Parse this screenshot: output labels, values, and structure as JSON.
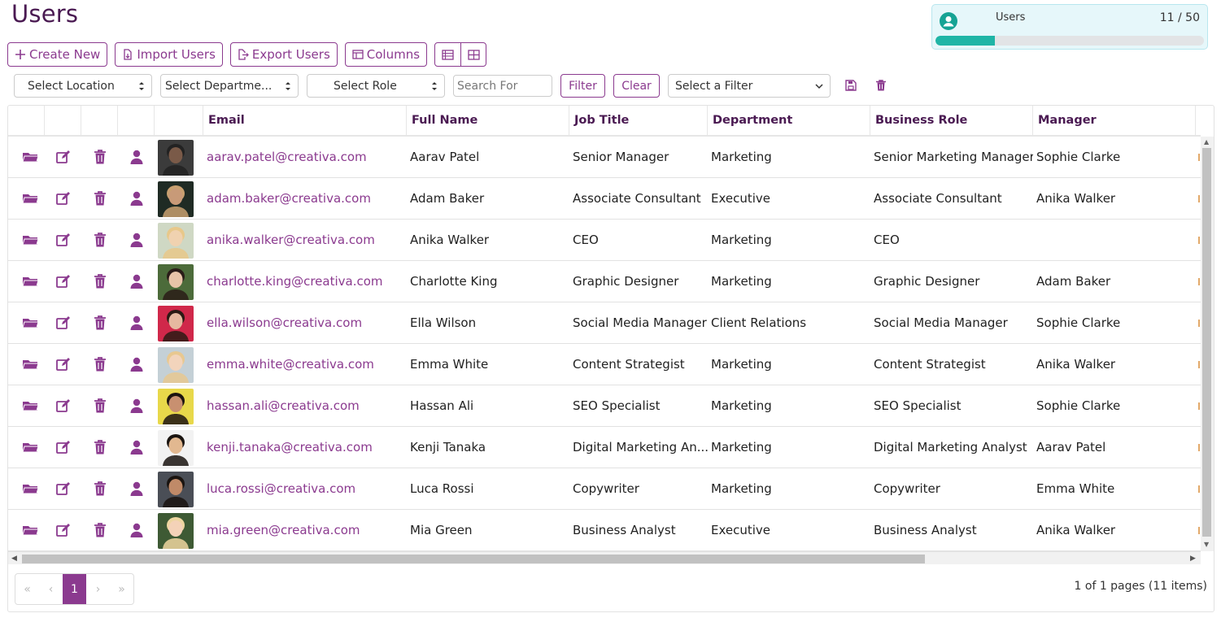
{
  "page": {
    "title": "Users"
  },
  "quota": {
    "label": "Users",
    "count": "11 / 50",
    "used": 11,
    "max": 50,
    "bar_color": "#1fb5a6",
    "icon": "user-circle-icon"
  },
  "toolbar": {
    "create_new": "Create New",
    "import_users": "Import Users",
    "export_users": "Export Users",
    "columns": "Columns"
  },
  "filters": {
    "location": "Select Location",
    "department": "Select Departme...",
    "role": "Select Role",
    "search_placeholder": "Search For",
    "filter_button": "Filter",
    "clear_button": "Clear",
    "saved_filter": "Select a Filter"
  },
  "columns": [
    "Email",
    "Full Name",
    "Job Title",
    "Department",
    "Business Role",
    "Manager"
  ],
  "rows": [
    {
      "email": "aarav.patel@creativa.com",
      "name": "Aarav Patel",
      "job": "Senior Manager",
      "dept": "Marketing",
      "role": "Senior Marketing Manager",
      "manager": "Sophie Clarke"
    },
    {
      "email": "adam.baker@creativa.com",
      "name": "Adam Baker",
      "job": "Associate Consultant",
      "dept": "Executive",
      "role": "Associate Consultant",
      "manager": "Anika Walker"
    },
    {
      "email": "anika.walker@creativa.com",
      "name": "Anika Walker",
      "job": "CEO",
      "dept": "Marketing",
      "role": "CEO",
      "manager": ""
    },
    {
      "email": "charlotte.king@creativa.com",
      "name": "Charlotte King",
      "job": "Graphic Designer",
      "dept": "Marketing",
      "role": "Graphic Designer",
      "manager": "Adam Baker"
    },
    {
      "email": "ella.wilson@creativa.com",
      "name": "Ella Wilson",
      "job": "Social Media Manager",
      "dept": "Client Relations",
      "role": "Social Media Manager",
      "manager": "Sophie Clarke"
    },
    {
      "email": "emma.white@creativa.com",
      "name": "Emma White",
      "job": "Content Strategist",
      "dept": "Marketing",
      "role": "Content Strategist",
      "manager": "Anika Walker"
    },
    {
      "email": "hassan.ali@creativa.com",
      "name": "Hassan Ali",
      "job": "SEO Specialist",
      "dept": "Marketing",
      "role": "SEO Specialist",
      "manager": "Sophie Clarke"
    },
    {
      "email": "kenji.tanaka@creativa.com",
      "name": "Kenji Tanaka",
      "job": "Digital Marketing An...",
      "dept": "Marketing",
      "role": "Digital Marketing Analyst",
      "manager": "Aarav Patel"
    },
    {
      "email": "luca.rossi@creativa.com",
      "name": "Luca Rossi",
      "job": "Copywriter",
      "dept": "Marketing",
      "role": "Copywriter",
      "manager": "Emma White"
    },
    {
      "email": "mia.green@creativa.com",
      "name": "Mia Green",
      "job": "Business Analyst",
      "dept": "Executive",
      "role": "Business Analyst",
      "manager": "Anika Walker"
    }
  ],
  "pager": {
    "first": "«",
    "prev": "‹",
    "current": "1",
    "next": "›",
    "last": "»",
    "info": "1 of 1 pages (11 items)"
  },
  "colors": {
    "accent": "#8b3a8f",
    "title": "#4a1a52",
    "teal": "#1fb5a6"
  }
}
